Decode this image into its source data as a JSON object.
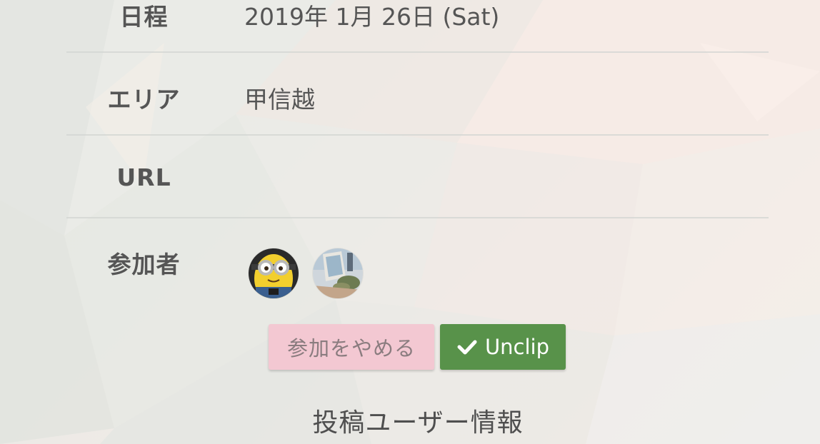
{
  "event_info": {
    "rows": [
      {
        "label": "日程",
        "value": "2019年 1月 26日 (Sat)"
      },
      {
        "label": "エリア",
        "value": "甲信越"
      },
      {
        "label": "URL",
        "value": ""
      },
      {
        "label": "参加者",
        "value": ""
      }
    ],
    "participants": [
      {
        "icon": "minion-avatar-icon"
      },
      {
        "icon": "photo-avatar-icon"
      }
    ]
  },
  "actions": {
    "cancel_label": "参加をやめる",
    "unclip_label": "Unclip",
    "unclip_icon": "checkmark-icon"
  },
  "section": {
    "title": "投稿ユーザー情報"
  },
  "colors": {
    "cancel_bg": "#f3c8d2",
    "unclip_bg": "#58924a",
    "text": "#555555"
  }
}
